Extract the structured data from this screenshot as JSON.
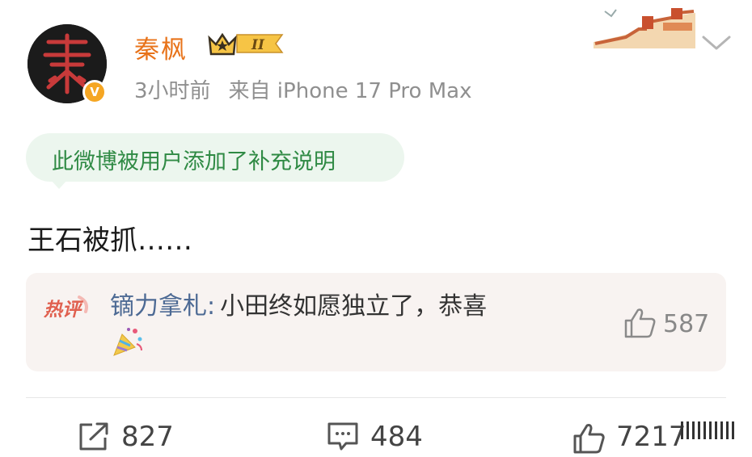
{
  "user": {
    "name": "秦枫",
    "level_badge": "II",
    "verified_badge": "V",
    "time": "3小时前",
    "source": "来自 iPhone 17 Pro Max"
  },
  "note": {
    "text": "此微博被用户添加了补充说明"
  },
  "post": {
    "text": "王石被抓……"
  },
  "hot_comment": {
    "tag": "热评",
    "author": "镝力拿札",
    "colon": ":",
    "text": "小田终如愿独立了，恭喜",
    "likes": "587"
  },
  "actions": {
    "share_count": "827",
    "comment_count": "484",
    "like_count": "7217"
  },
  "colors": {
    "username": "#e8731a",
    "note_green": "#2f8a44",
    "hot_author": "#4d6a94",
    "verified": "#f5a623"
  },
  "icons": {
    "more": "chevron-down-icon",
    "share": "share-icon",
    "comment": "comment-icon",
    "like": "thumbs-up-icon"
  }
}
